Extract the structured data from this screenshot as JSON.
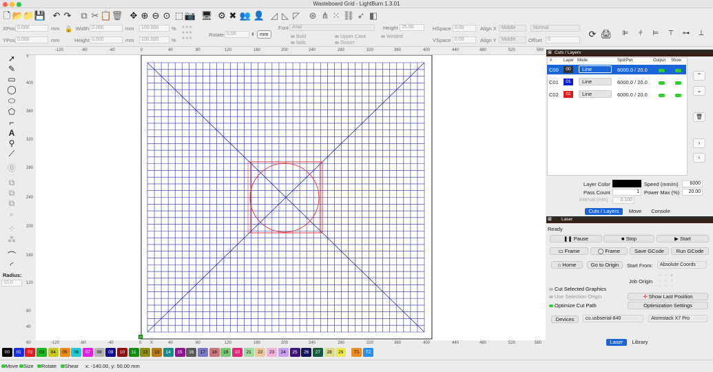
{
  "window": {
    "title": "Wasteboard Grid - LightBurn 1.3.01"
  },
  "main_toolbar": {
    "icons": [
      "new-icon",
      "open-icon",
      "import-icon",
      "save-icon",
      "undo-icon",
      "redo-icon",
      "copy-icon",
      "cut-icon",
      "paste-icon",
      "delete-icon",
      "move-icon",
      "zoom-in-icon",
      "zoom-out-icon",
      "zoom-frame-icon",
      "zoom-selection-icon",
      "camera-icon",
      "monitor-icon",
      "settings-icon",
      "tools-icon",
      "users-icon",
      "user-icon",
      "triangle-icon",
      "triangle-arrow-icon",
      "triangle-dashed-icon",
      "target-icon",
      "nodes-icon",
      "dots-icon",
      "chain-icon",
      "arrow-icon",
      "fill-icon"
    ]
  },
  "options": {
    "xpos_label": "XPos",
    "xpos": "0.000",
    "ypos_label": "YPos",
    "ypos": "0.000",
    "mm": "mm",
    "width_label": "Width",
    "width": "0.000",
    "height_label": "Height",
    "height": "0.000",
    "pct_w": "100.000",
    "pct_h": "100.000",
    "pct": "%",
    "rotate_label": "Rotate",
    "rotate": "0.00",
    "mm_btn": "mm",
    "font_label": "Font",
    "font": "Arial",
    "text_height_label": "Height",
    "text_height": "25.00",
    "hspace_label": "HSpace",
    "hspace": "0.00",
    "vspace_label": "VSpace",
    "vspace": "0.00",
    "alignx_label": "Align X",
    "alignx": "Middle",
    "aligny_label": "Align Y",
    "aligny": "Middle",
    "style": "Normal",
    "offset_label": "Offset",
    "offset": "0",
    "bold": "Bold",
    "italic": "Italic",
    "upper_case": "Upper Case",
    "welded": "Welded",
    "distort": "Distort"
  },
  "rulers": {
    "top": [
      "-120",
      "-80",
      "-40",
      "0",
      "40",
      "80",
      "120",
      "160",
      "200",
      "240",
      "280",
      "320",
      "360",
      "400",
      "440",
      "480",
      "520",
      "560"
    ],
    "bottom": [
      "60",
      "-120",
      "-80",
      "-40",
      "0",
      "X",
      "40",
      "80",
      "120",
      "160",
      "200",
      "240",
      "280",
      "320",
      "360",
      "400",
      "440",
      "480",
      "520",
      "560"
    ],
    "left": [
      "400",
      "360",
      "320",
      "280",
      "240",
      "200",
      "160",
      "120",
      "80",
      "40",
      "Y"
    ]
  },
  "left_tools": {
    "radius_label": "Radius:",
    "radius": "10.0"
  },
  "cuts_panel": {
    "title": "Cuts / Layers",
    "headers": [
      "#",
      "Layer",
      "Mode",
      "Spd/Pwr",
      "Output",
      "Show"
    ],
    "rows": [
      {
        "id": "C00",
        "layer": "00",
        "mode": "Line",
        "spdpwr": "6000.0 / 20.0",
        "color": "#333333"
      },
      {
        "id": "C01",
        "layer": "01",
        "mode": "Line",
        "spdpwr": "6000.0 / 20.0",
        "color": "#1020d8"
      },
      {
        "id": "C02",
        "layer": "02",
        "mode": "Line",
        "spdpwr": "6000.0 / 20.0",
        "color": "#e01818"
      }
    ],
    "layer_color_label": "Layer Color",
    "speed_label": "Speed (mm/m)",
    "speed": "6000",
    "pass_label": "Pass Count",
    "pass": "1",
    "power_label": "Power Max (%)",
    "power": "20.00",
    "interval_label": "Interval (mm)",
    "interval": "0.100",
    "tabs": [
      "Cuts / Layers",
      "Move",
      "Console"
    ]
  },
  "laser_panel": {
    "title": "Laser",
    "status": "Ready",
    "pause": "Pause",
    "stop": "Stop",
    "start": "Start",
    "frame1": "Frame",
    "frame2": "Frame",
    "save_gcode": "Save GCode",
    "run_gcode": "Run GCode",
    "home": "Home",
    "go_to_origin": "Go to Origin",
    "start_from_label": "Start From:",
    "start_from": "Absolute Coords",
    "job_origin": "Job Origin",
    "cut_selected": "Cut Selected Graphics",
    "use_selection_origin": "Use Selection Origin",
    "optimize_cut_path": "Optimize Cut Path",
    "show_last_position": "Show Last Position",
    "optimization_settings": "Optimization Settings",
    "devices": "Devices",
    "port": "cu.usbserial-840",
    "device": "Atomstack X7 Pro",
    "tabs": [
      "Laser",
      "Library"
    ]
  },
  "palette": [
    {
      "label": "00",
      "color": "#000000",
      "fg": "#ffffff"
    },
    {
      "label": "01",
      "color": "#1530e0",
      "fg": "#ffffff"
    },
    {
      "label": "02",
      "color": "#e01c1c",
      "fg": "#ffffff"
    },
    {
      "label": "03",
      "color": "#1eb41e",
      "fg": "#000000"
    },
    {
      "label": "04",
      "color": "#c8c820",
      "fg": "#000000"
    },
    {
      "label": "05",
      "color": "#f08c14",
      "fg": "#000000"
    },
    {
      "label": "06",
      "color": "#20c8d8",
      "fg": "#000000"
    },
    {
      "label": "07",
      "color": "#e020e0",
      "fg": "#ffffff"
    },
    {
      "label": "08",
      "color": "#b4b4b4",
      "fg": "#000000"
    },
    {
      "label": "09",
      "color": "#10108c",
      "fg": "#ffffff"
    },
    {
      "label": "10",
      "color": "#8c1010",
      "fg": "#ffffff"
    },
    {
      "label": "11",
      "color": "#108c10",
      "fg": "#ffffff"
    },
    {
      "label": "12",
      "color": "#8c8c10",
      "fg": "#000000"
    },
    {
      "label": "13",
      "color": "#b47814",
      "fg": "#000000"
    },
    {
      "label": "14",
      "color": "#148c8c",
      "fg": "#ffffff"
    },
    {
      "label": "15",
      "color": "#8c148c",
      "fg": "#ffffff"
    },
    {
      "label": "16",
      "color": "#5a5a5a",
      "fg": "#ffffff"
    },
    {
      "label": "17",
      "color": "#7878c8",
      "fg": "#000000"
    },
    {
      "label": "18",
      "color": "#c87878",
      "fg": "#000000"
    },
    {
      "label": "19",
      "color": "#78c878",
      "fg": "#000000"
    },
    {
      "label": "20",
      "color": "#e02878",
      "fg": "#ffffff"
    },
    {
      "label": "21",
      "color": "#a0dca0",
      "fg": "#000000"
    },
    {
      "label": "22",
      "color": "#f0c8a0",
      "fg": "#000000"
    },
    {
      "label": "23",
      "color": "#f0b4dc",
      "fg": "#000000"
    },
    {
      "label": "24",
      "color": "#c8a0f0",
      "fg": "#000000"
    },
    {
      "label": "25",
      "color": "#3c1478",
      "fg": "#ffffff"
    },
    {
      "label": "26",
      "color": "#14145a",
      "fg": "#ffffff"
    },
    {
      "label": "27",
      "color": "#145a3c",
      "fg": "#ffffff"
    },
    {
      "label": "28",
      "color": "#dcdc8c",
      "fg": "#000000"
    },
    {
      "label": "29",
      "color": "#eaea50",
      "fg": "#000000"
    },
    {
      "label": "T1",
      "color": "#f08c28",
      "fg": "#000000"
    },
    {
      "label": "T2",
      "color": "#2890f0",
      "fg": "#ffffff"
    }
  ],
  "statusbar": {
    "move": "Move",
    "size": "Size",
    "rotate": "Rotate",
    "shear": "Shear",
    "coords": "x: -140.00, y: 50.00 mm"
  }
}
